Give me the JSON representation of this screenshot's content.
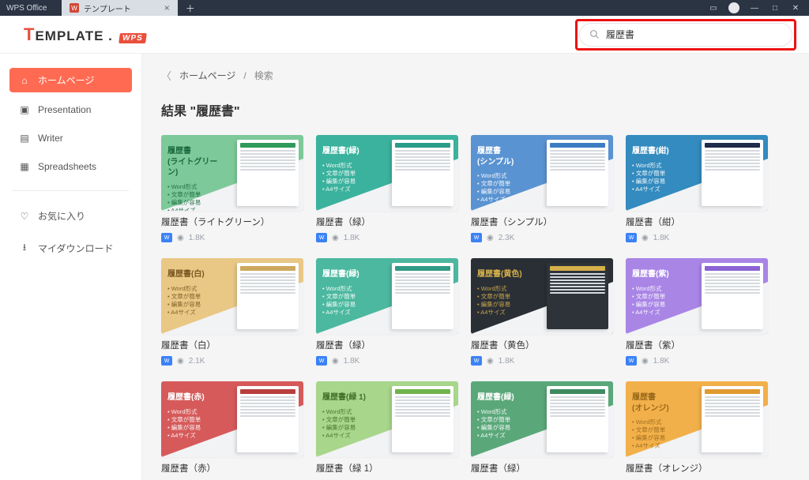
{
  "titlebar": {
    "app": "WPS Office",
    "tab_label": "テンプレート",
    "tab_icon_text": "W"
  },
  "logo": {
    "t": "T",
    "rest": "EMPLATE",
    "dot": ".",
    "badge": "WPS"
  },
  "search": {
    "value": "履歴書"
  },
  "sidebar": {
    "items": [
      {
        "label": "ホームページ",
        "icon": "⌂",
        "active": true
      },
      {
        "label": "Presentation",
        "icon": "▣",
        "active": false
      },
      {
        "label": "Writer",
        "icon": "▤",
        "active": false
      },
      {
        "label": "Spreadsheets",
        "icon": "▦",
        "active": false
      }
    ],
    "extras": [
      {
        "label": "お気に入り",
        "icon": "♡"
      },
      {
        "label": "マイダウンロード",
        "icon": "⭳"
      }
    ]
  },
  "breadcrumb": {
    "home": "ホームページ",
    "sep": "/",
    "current": "検索"
  },
  "result_prefix": "結果 ",
  "result_term": "\"履歴書\"",
  "bullets": [
    "Word形式",
    "文章が簡単",
    "編集が容易",
    "A4サイズ"
  ],
  "cards": [
    {
      "thumb_title": "履歴書\n(ライトグリーン)",
      "title": "履歴書（ライトグリーン）",
      "views": "1.8K",
      "color": "#7ec99a",
      "text": "#1a6b3e",
      "accent": "#2f9a5a"
    },
    {
      "thumb_title": "履歴書(緑)",
      "title": "履歴書（緑）",
      "views": "1.8K",
      "color": "#3bb29d",
      "text": "#ffffff",
      "accent": "#2a9c88"
    },
    {
      "thumb_title": "履歴書\n(シンプル)",
      "title": "履歴書（シンプル）",
      "views": "2.3K",
      "color": "#5a93d1",
      "text": "#ffffff",
      "accent": "#3c7cc2"
    },
    {
      "thumb_title": "履歴書(紺)",
      "title": "履歴書（紺）",
      "views": "1.8K",
      "color": "#338bbf",
      "text": "#ffffff",
      "accent": "#1f2b4a"
    },
    {
      "thumb_title": "履歴書(白)",
      "title": "履歴書（白）",
      "views": "2.1K",
      "color": "#e9c885",
      "text": "#7a5a22",
      "accent": "#cda85e"
    },
    {
      "thumb_title": "履歴書(緑)",
      "title": "履歴書（緑）",
      "views": "1.8K",
      "color": "#4bb89f",
      "text": "#ffffff",
      "accent": "#2f9a85"
    },
    {
      "thumb_title": "履歴書(黄色)",
      "title": "履歴書（黄色）",
      "views": "1.8K",
      "color": "#2a2f36",
      "text": "#d6b04a",
      "accent": "#d6b04a",
      "dark": true
    },
    {
      "thumb_title": "履歴書(紫)",
      "title": "履歴書（紫）",
      "views": "1.8K",
      "color": "#a985e6",
      "text": "#ffffff",
      "accent": "#8b63d4"
    },
    {
      "thumb_title": "履歴書(赤)",
      "title": "履歴書（赤）",
      "views": "",
      "color": "#d65a5a",
      "text": "#ffffff",
      "accent": "#b93f3f"
    },
    {
      "thumb_title": "履歴書(緑 1)",
      "title": "履歴書（緑 1）",
      "views": "",
      "color": "#a8d68a",
      "text": "#44702b",
      "accent": "#6fb34a"
    },
    {
      "thumb_title": "履歴書(緑)",
      "title": "履歴書（緑）",
      "views": "",
      "color": "#5aa87a",
      "text": "#ffffff",
      "accent": "#3f8a5f"
    },
    {
      "thumb_title": "履歴書\n(オレンジ)",
      "title": "履歴書（オレンジ）",
      "views": "",
      "color": "#f2b04a",
      "text": "#9a6a1a",
      "accent": "#e09a30"
    }
  ]
}
